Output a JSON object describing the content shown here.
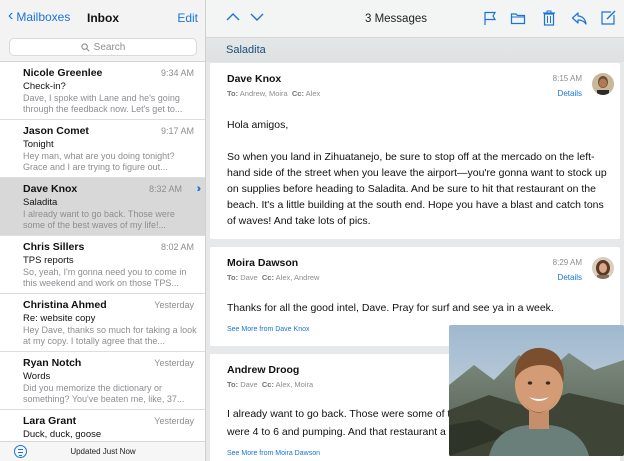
{
  "mailbox": {
    "back_label": "Mailboxes",
    "title": "Inbox",
    "edit_label": "Edit",
    "search_placeholder": "Search",
    "status": "Updated Just Now"
  },
  "messages": [
    {
      "sender": "Nicole Greenlee",
      "time": "9:34 AM",
      "subject": "Check-in?",
      "preview": "Dave, I spoke with Lane and he's going through the feedback now. Let's get to..."
    },
    {
      "sender": "Jason Comet",
      "time": "9:17 AM",
      "subject": "Tonight",
      "preview": "Hey man, what are you doing tonight? Grace and I are trying to figure out..."
    },
    {
      "sender": "Dave Knox",
      "time": "8:32 AM",
      "subject": "Saladita",
      "preview": "I already want to go back. Those were some of the best waves of my life!..."
    },
    {
      "sender": "Chris Sillers",
      "time": "8:02 AM",
      "subject": "TPS reports",
      "preview": "So, yeah, I'm gonna need you to come in this weekend and work on those TPS..."
    },
    {
      "sender": "Christina Ahmed",
      "time": "Yesterday",
      "subject": "Re: website copy",
      "preview": "Hey Dave, thanks so much for taking a look at my copy. I totally agree that the..."
    },
    {
      "sender": "Ryan Notch",
      "time": "Yesterday",
      "subject": "Words",
      "preview": "Did you memorize the dictionary or something? You've beaten me, like, 37..."
    },
    {
      "sender": "Lara Grant",
      "time": "Yesterday",
      "subject": "Duck, duck, goose",
      "preview": ""
    }
  ],
  "toolbar": {
    "count": "3 Messages",
    "icons": [
      "chevron-up-icon",
      "chevron-down-icon",
      "flag-icon",
      "folder-icon",
      "trash-icon",
      "reply-icon",
      "compose-icon"
    ]
  },
  "thread": {
    "title": "Saladita",
    "emails": [
      {
        "from": "Dave Knox",
        "to_label": "To:",
        "to": "Andrew, Moira",
        "cc_label": "Cc:",
        "cc": "Alex",
        "time": "8:15 AM",
        "details": "Details",
        "greeting": "Hola amigos,",
        "body": "So when you land in Zihuatanejo, be sure to stop off at the mercado on the left-hand side of the street when you leave the airport—you're gonna want to stock up on supplies before heading to Saladita. And be sure to hit that restaurant on the beach. It's a little building at the south end. Hope you have a blast and catch tons of waves! And take lots of pics."
      },
      {
        "from": "Moira Dawson",
        "to_label": "To:",
        "to": "Dave",
        "cc_label": "Cc:",
        "cc": "Alex, Andrew",
        "time": "8:29 AM",
        "details": "Details",
        "body": "Thanks for all the good intel, Dave. Pray for surf and see ya in a week.",
        "see_more": "See More from Dave Knox"
      },
      {
        "from": "Andrew Droog",
        "to_label": "To:",
        "to": "Dave",
        "cc_label": "Cc:",
        "cc": "Alex, Moira",
        "body": "I already want to go back. Those were some of the best waves... were 4 to 6 and pumping. And that restaurant a...",
        "body_line1": "I already want to go back. Those were some of t",
        "body_line2": "were 4 to 6 and pumping. And that restaurant a",
        "see_more": "See More from Moira Dawson"
      }
    ]
  },
  "colors": {
    "accent": "#1a73d9",
    "selected_row": "#d8d8d8",
    "thread_bg": "#e6e8e9"
  }
}
